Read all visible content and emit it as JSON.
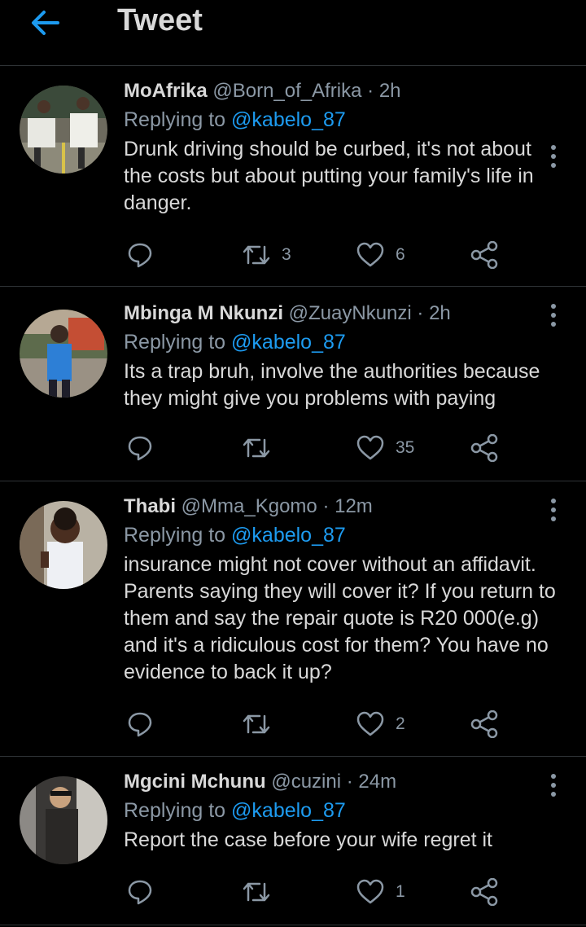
{
  "header": {
    "title": "Tweet"
  },
  "tweets": [
    {
      "name": "MoAfrika",
      "handle": "@Born_of_Afrika",
      "sep": "·",
      "time": "2h",
      "replying_prefix": "Replying to ",
      "replying_to": "@kabelo_87",
      "text": "Drunk driving should be curbed,  it's not about the costs but about putting your family's life in danger.",
      "retweets": "3",
      "likes": "6"
    },
    {
      "name": "Mbinga M Nkunzi",
      "handle": "@ZuayNkunzi",
      "sep": "·",
      "time": "2h",
      "replying_prefix": "Replying to ",
      "replying_to": "@kabelo_87",
      "text": "Its a trap bruh, involve the authorities because they might give you problems with paying",
      "retweets": "",
      "likes": "35"
    },
    {
      "name": "Thabi",
      "handle": "@Mma_Kgomo",
      "sep": "·",
      "time": "12m",
      "replying_prefix": "Replying to ",
      "replying_to": "@kabelo_87",
      "text": "insurance might not cover without an affidavit. Parents saying they will cover it? If you return to them and say the repair quote is R20 000(e.g) and it's a ridiculous cost for them? You have no evidence to back it up?",
      "retweets": "",
      "likes": "2"
    },
    {
      "name": "Mgcini Mchunu",
      "handle": "@cuzini",
      "sep": "·",
      "time": "24m",
      "replying_prefix": "Replying to ",
      "replying_to": "@kabelo_87",
      "text": "Report the case before your wife regret it",
      "retweets": "",
      "likes": "1"
    }
  ],
  "colors": {
    "accent": "#1d9bf0",
    "background": "#000000",
    "muted": "#8b98a5",
    "divider": "#2f3336"
  },
  "icons": [
    "back-arrow-icon",
    "more-vertical-icon",
    "reply-icon",
    "retweet-icon",
    "like-icon",
    "share-icon"
  ]
}
